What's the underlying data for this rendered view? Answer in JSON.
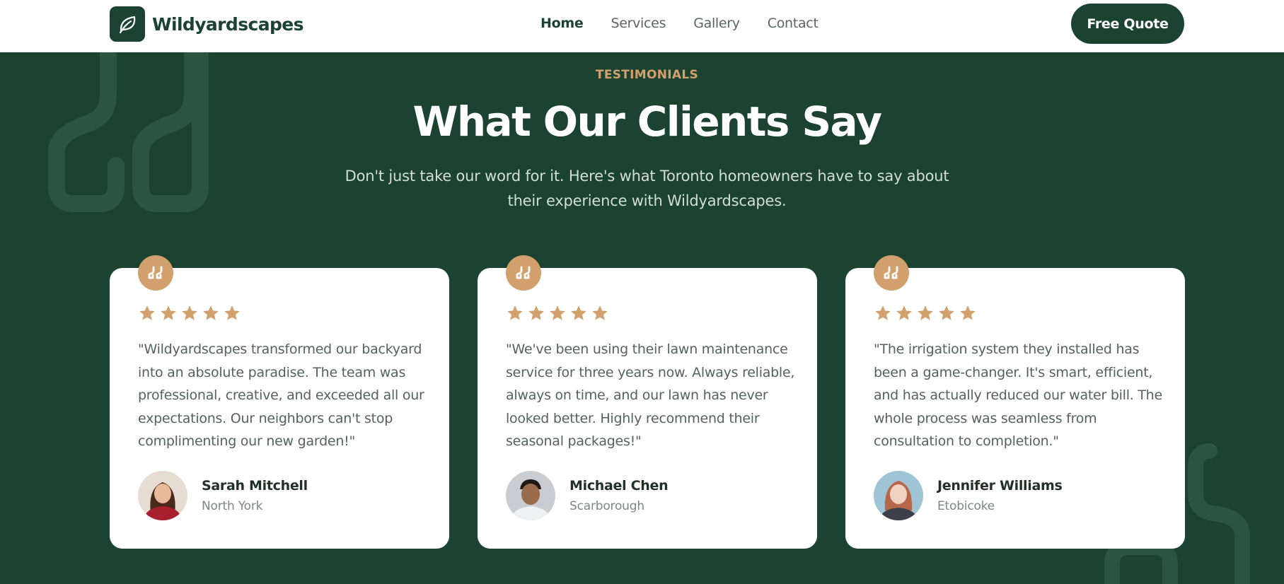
{
  "header": {
    "brand": "Wildyardscapes",
    "logo_icon": "leaf-icon",
    "nav": [
      "Home",
      "Services",
      "Gallery",
      "Contact"
    ],
    "active_nav": "Home",
    "cta": "Free Quote"
  },
  "testimonials": {
    "eyebrow": "TESTIMONIALS",
    "title": "What Our Clients Say",
    "subtitle": "Don't just take our word for it. Here's what Toronto homeowners have to say about their experience with Wildyardscapes.",
    "items": [
      {
        "rating": 5,
        "quote": "\"Wildyardscapes transformed our backyard into an absolute paradise. The team was professional, creative, and exceeded all our expectations. Our neighbors can't stop complimenting our new garden!\"",
        "name": "Sarah Mitchell",
        "location": "North York"
      },
      {
        "rating": 5,
        "quote": "\"We've been using their lawn maintenance service for three years now. Always reliable, always on time, and our lawn has never looked better. Highly recommend their seasonal packages!\"",
        "name": "Michael Chen",
        "location": "Scarborough"
      },
      {
        "rating": 5,
        "quote": "\"The irrigation system they installed has been a game-changer. It's smart, efficient, and has actually reduced our water bill. The whole process was seamless from consultation to completion.\"",
        "name": "Jennifer Williams",
        "location": "Etobicoke"
      }
    ]
  },
  "colors": {
    "primary": "#1c4332",
    "accent": "#d2a06c",
    "white": "#ffffff"
  }
}
